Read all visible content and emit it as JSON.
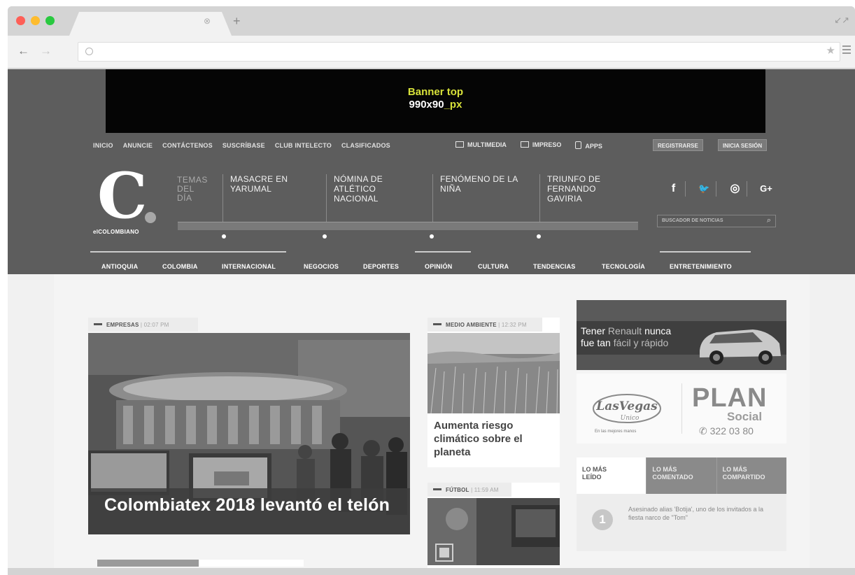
{
  "browser": {
    "tab_close": "⊗",
    "new_tab": "+",
    "resize": "↙↗",
    "back": "←",
    "forward": "→",
    "bookmark": "★"
  },
  "banner": {
    "line1": "Banner top",
    "line2_main": "990x90",
    "line2_suffix": "_px"
  },
  "topnav": [
    "INICIO",
    "ANUNCIE",
    "CONTÁCTENOS",
    "SUSCRÍBASE",
    "CLUB INTELECTO",
    "CLASIFICADOS"
  ],
  "media": [
    "MULTIMEDIA",
    "IMPRESO",
    "APPS"
  ],
  "auth": {
    "register": "REGISTRARSE",
    "login": "INICIA SESIÓN"
  },
  "logo": {
    "letter": "C",
    "text": "elCOLOMBIANO"
  },
  "temas": {
    "l1": "TEMAS",
    "l2": "DEL",
    "l3": "DÍA"
  },
  "topics": [
    {
      "l1": "MASACRE EN",
      "l2": "YARUMAL",
      "l3": ""
    },
    {
      "l1": "NÓMINA DE",
      "l2": "ATLÉTICO",
      "l3": "NACIONAL"
    },
    {
      "l1": "FENÓMENO DE LA",
      "l2": "NIÑA",
      "l3": ""
    },
    {
      "l1": "TRIUNFO DE",
      "l2": "FERNANDO",
      "l3": "GAVIRIA"
    }
  ],
  "social": [
    "f",
    "🐦",
    "◎",
    "G+"
  ],
  "search": {
    "placeholder": "BUSCADOR DE NOTICIAS",
    "icon": "⌕"
  },
  "mainnav": [
    "ANTIOQUIA",
    "COLOMBIA",
    "INTERNACIONAL",
    "NEGOCIOS",
    "DEPORTES",
    "OPINIÓN",
    "CULTURA",
    "TENDENCIAS",
    "TECNOLOGÍA",
    "ENTRETENIMIENTO"
  ],
  "hero": {
    "section": "EMPRESAS",
    "time": "02:07 PM",
    "title": "Colombiatex 2018 levantó el telón"
  },
  "side1": {
    "section": "MEDIO AMBIENTE",
    "time": "12:32 PM",
    "title": "Aumenta riesgo climático sobre el planeta"
  },
  "side2": {
    "section": "FÚTBOL",
    "time": "11:59 AM"
  },
  "ad_renault": {
    "w1": "Tener",
    "w2": "Renault",
    "w3": "nunca",
    "w4": "fue tan",
    "w5": "fácil y rápido"
  },
  "ad_plan": {
    "plan": "PLAN",
    "social": "Social",
    "phone": "✆ 322 03 80",
    "lv_name": "LasVegas",
    "lv_sub": "Unico",
    "lv_tag": "En las mejores manos"
  },
  "tabs": [
    {
      "l1": "LO MÁS",
      "l2": "LEÍDO"
    },
    {
      "l1": "LO MÁS",
      "l2": "COMENTADO"
    },
    {
      "l1": "LO MÁS",
      "l2": "COMPARTIDO"
    }
  ],
  "most_read": {
    "num": "1",
    "text": "Asesinado alias 'Botija', uno de los invitados a la fiesta narco de \"Tom\""
  },
  "colors": {
    "header_bg": "#5d5d5d",
    "banner_bg": "#050505",
    "banner_accent": "#d8e23a",
    "dot_red": "#fe5f57",
    "dot_yellow": "#febc2e",
    "dot_green": "#29c940"
  }
}
